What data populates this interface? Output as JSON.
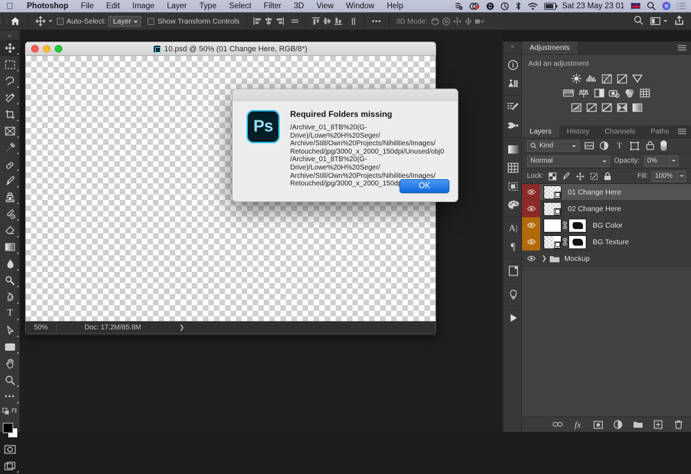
{
  "menubar": {
    "apple_icon": "apple-logo",
    "items": [
      "Photoshop",
      "File",
      "Edit",
      "Image",
      "Layer",
      "Type",
      "Select",
      "Filter",
      "3D",
      "View",
      "Window",
      "Help"
    ],
    "status_icons": [
      "dropbox-sync-icon",
      "recording-icon",
      "shazam-icon",
      "time-machine-icon",
      "bluetooth-icon",
      "wifi-icon",
      "battery-icon"
    ],
    "clock": "Sat 23 May  23 01",
    "input_flag": "uk-flag-icon",
    "spotlight_icon": "search-icon",
    "siri_icon": "siri-icon",
    "control_center_icon": "list-icon"
  },
  "options_bar": {
    "home_icon": "home-icon",
    "tool_icon": "move-tool-icon",
    "auto_select_label": "Auto-Select:",
    "auto_select_value": "Layer",
    "show_transform_label": "Show Transform Controls",
    "align_icons": [
      "align-left-icon",
      "align-center-h-icon",
      "align-right-icon",
      "distribute-h-icon",
      "align-top-icon",
      "align-middle-v-icon",
      "align-bottom-icon",
      "distribute-v-icon"
    ],
    "more_label": "•••",
    "mode_3d_label": "3D Mode:",
    "mode_3d_icons": [
      "orbit-3d-icon",
      "roll-3d-icon",
      "pan-3d-icon",
      "slide-3d-icon",
      "zoom-3d-icon"
    ],
    "search_icon": "search-icon",
    "workspace_icon": "workspace-icon",
    "share_icon": "share-icon"
  },
  "toolbar": {
    "tools": [
      {
        "name": "move-tool",
        "glyph": "move",
        "active": true
      },
      {
        "name": "marquee-tool",
        "glyph": "marquee",
        "active": false
      },
      {
        "name": "lasso-tool",
        "glyph": "lasso",
        "active": false
      },
      {
        "name": "quick-selection-tool",
        "glyph": "wand",
        "active": false
      },
      {
        "name": "crop-tool",
        "glyph": "crop",
        "active": false
      },
      {
        "name": "frame-tool",
        "glyph": "frame",
        "active": false
      },
      {
        "name": "eyedropper-tool",
        "glyph": "eyedropper",
        "active": false
      },
      {
        "name": "healing-brush-tool",
        "glyph": "heal",
        "active": false
      },
      {
        "name": "brush-tool",
        "glyph": "brush",
        "active": false
      },
      {
        "name": "clone-stamp-tool",
        "glyph": "stamp",
        "active": false
      },
      {
        "name": "history-brush-tool",
        "glyph": "history-brush",
        "active": false
      },
      {
        "name": "eraser-tool",
        "glyph": "eraser",
        "active": false
      },
      {
        "name": "gradient-tool",
        "glyph": "gradient",
        "active": false
      },
      {
        "name": "blur-tool",
        "glyph": "blur",
        "active": false
      },
      {
        "name": "dodge-tool",
        "glyph": "dodge",
        "active": false
      },
      {
        "name": "pen-tool",
        "glyph": "pen",
        "active": false
      },
      {
        "name": "type-tool",
        "glyph": "type",
        "active": false
      },
      {
        "name": "path-selection-tool",
        "glyph": "path-arrow",
        "active": false
      },
      {
        "name": "rectangle-tool",
        "glyph": "rectangle",
        "active": false
      },
      {
        "name": "hand-tool",
        "glyph": "hand",
        "active": false
      },
      {
        "name": "zoom-tool",
        "glyph": "zoom",
        "active": false
      },
      {
        "name": "edit-toolbar",
        "glyph": "ellipsis",
        "active": false
      },
      {
        "name": "default-colors",
        "glyph": "default-colors",
        "active": false
      }
    ],
    "foreground_color": "#000000",
    "background_color": "#ffffff",
    "quick-mask-icon": "quick-mask",
    "screen-mode-icon": "screen-mode"
  },
  "document": {
    "title": "10.psd @ 50% (01 Change Here, RGB/8*)",
    "zoom": "50%",
    "doc_size": "Doc: 17.2M/85.8M"
  },
  "dialog": {
    "app_icon": "photoshop-icon",
    "app_icon_text": "Ps",
    "title": "Required Folders missing",
    "message": "/Archive_01_8TB%20(G-Drive)/Lowe%20H%20Seger/\nArchive/Still/Own%20Projects/Nihilities/Images/\nRetouched/jpg/3000_x_2000_150dpi/Unused/obj0\n/Archive_01_8TB%20(G-Drive)/Lowe%20H%20Seger/\nArchive/Still/Own%20Projects/Nihilities/Images/\nRetouched/jpg/3000_x_2000_150dpi/Unused/obj1",
    "ok_label": "OK",
    "accent_color": "#2a7fe8"
  },
  "dock_rail": {
    "collapse_icon": "collapse-panels-icon",
    "icons": [
      "info-panel-icon",
      "libraries-panel-icon",
      "brush-settings-panel-icon",
      "brushes-panel-icon",
      "gradients-panel-icon",
      "patterns-panel-icon",
      "shapes-panel-icon",
      "swatches-panel-icon",
      "character-panel-icon",
      "paragraph-panel-icon",
      "layer-comps-panel-icon",
      "learn-panel-icon",
      "actions-panel-icon"
    ]
  },
  "adjustments_panel": {
    "tab_label": "Adjustments",
    "menu_icon": "panel-menu-icon",
    "hint": "Add an adjustment",
    "rows": [
      [
        "brightness-contrast-icon",
        "levels-icon",
        "curves-icon",
        "exposure-icon",
        "vibrance-icon"
      ],
      [
        "hue-saturation-icon",
        "color-balance-icon",
        "black-white-icon",
        "photo-filter-icon",
        "channel-mixer-icon",
        "color-lookup-icon"
      ],
      [
        "invert-icon",
        "posterize-icon",
        "threshold-icon",
        "selective-color-icon",
        "gradient-map-icon"
      ]
    ]
  },
  "layers_panel": {
    "tabs": [
      {
        "label": "Layers",
        "active": true
      },
      {
        "label": "History",
        "active": false
      },
      {
        "label": "Channels",
        "active": false
      },
      {
        "label": "Paths",
        "active": false
      }
    ],
    "menu_icon": "panel-menu-icon",
    "filter": {
      "search_icon": "search-icon",
      "kind_label": "Kind",
      "type_icons": [
        "pixel-filter-icon",
        "adjustment-filter-icon",
        "type-filter-icon",
        "shape-filter-icon",
        "smart-object-filter-icon"
      ],
      "power_toggle": "filter-toggle"
    },
    "blend_mode": "Normal",
    "opacity_label": "Opacity:",
    "opacity_value": "0%",
    "lock_label": "Lock:",
    "lock_icons": [
      "lock-transparent-icon",
      "lock-image-icon",
      "lock-position-icon",
      "lock-artboard-icon",
      "lock-all-icon"
    ],
    "fill_label": "Fill:",
    "fill_value": "100%",
    "layers": [
      {
        "name": "01 Change Here",
        "selected": true,
        "eye_bg": "red",
        "type": "smart-object",
        "has_mask": false,
        "visible": true
      },
      {
        "name": "02 Change Here",
        "selected": false,
        "eye_bg": "red",
        "type": "smart-object-transparent",
        "has_mask": false,
        "visible": true
      },
      {
        "name": "BG Color",
        "selected": false,
        "eye_bg": "orange",
        "type": "solid",
        "has_mask": true,
        "visible": true
      },
      {
        "name": "BG Texture",
        "selected": false,
        "eye_bg": "orange",
        "type": "smart-object",
        "has_mask": true,
        "visible": true
      },
      {
        "name": "Mockup",
        "selected": false,
        "eye_bg": "none",
        "type": "group",
        "has_mask": false,
        "visible": true
      }
    ],
    "footer_icons": [
      "link-layers-icon",
      "layer-style-fx-icon",
      "add-mask-icon",
      "new-adjustment-icon",
      "new-group-icon",
      "new-layer-icon",
      "delete-layer-icon"
    ]
  }
}
